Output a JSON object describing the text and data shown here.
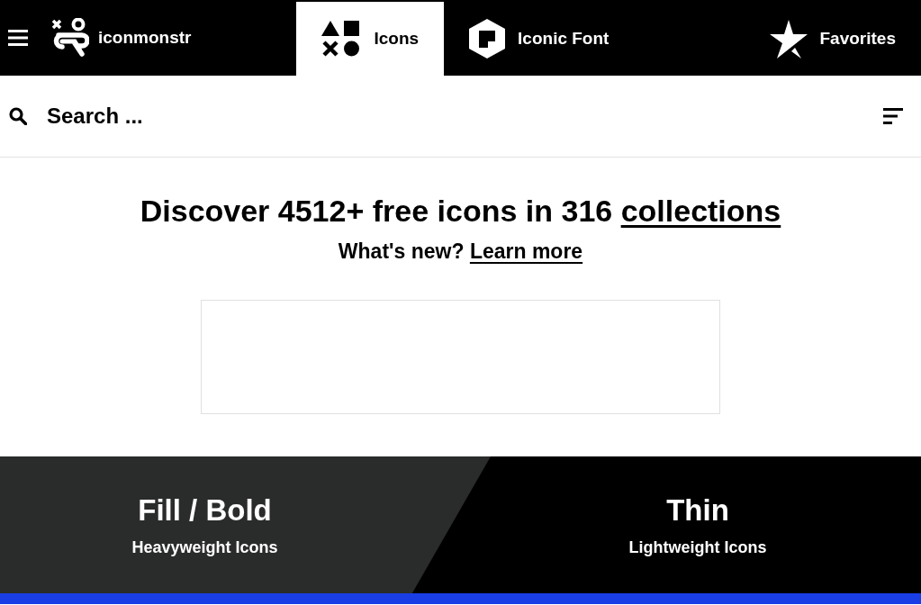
{
  "header": {
    "brand": "iconmonstr",
    "tabs": [
      {
        "label": "Icons",
        "kind": "shapes",
        "selected": true
      },
      {
        "label": "Iconic Font",
        "kind": "hexagon",
        "selected": false
      },
      {
        "label": "Favorites",
        "kind": "star",
        "selected": false
      }
    ]
  },
  "search": {
    "placeholder": "Search ..."
  },
  "hero": {
    "heading": "Discover 4512+ free icons in 316",
    "heading_link": "collections",
    "subheading": "What's new?",
    "subheading_link": "Learn more"
  },
  "styles": [
    {
      "title": "Fill / Bold",
      "subtitle": "Heavyweight Icons"
    },
    {
      "title": "Thin",
      "subtitle": "Lightweight Icons"
    }
  ]
}
